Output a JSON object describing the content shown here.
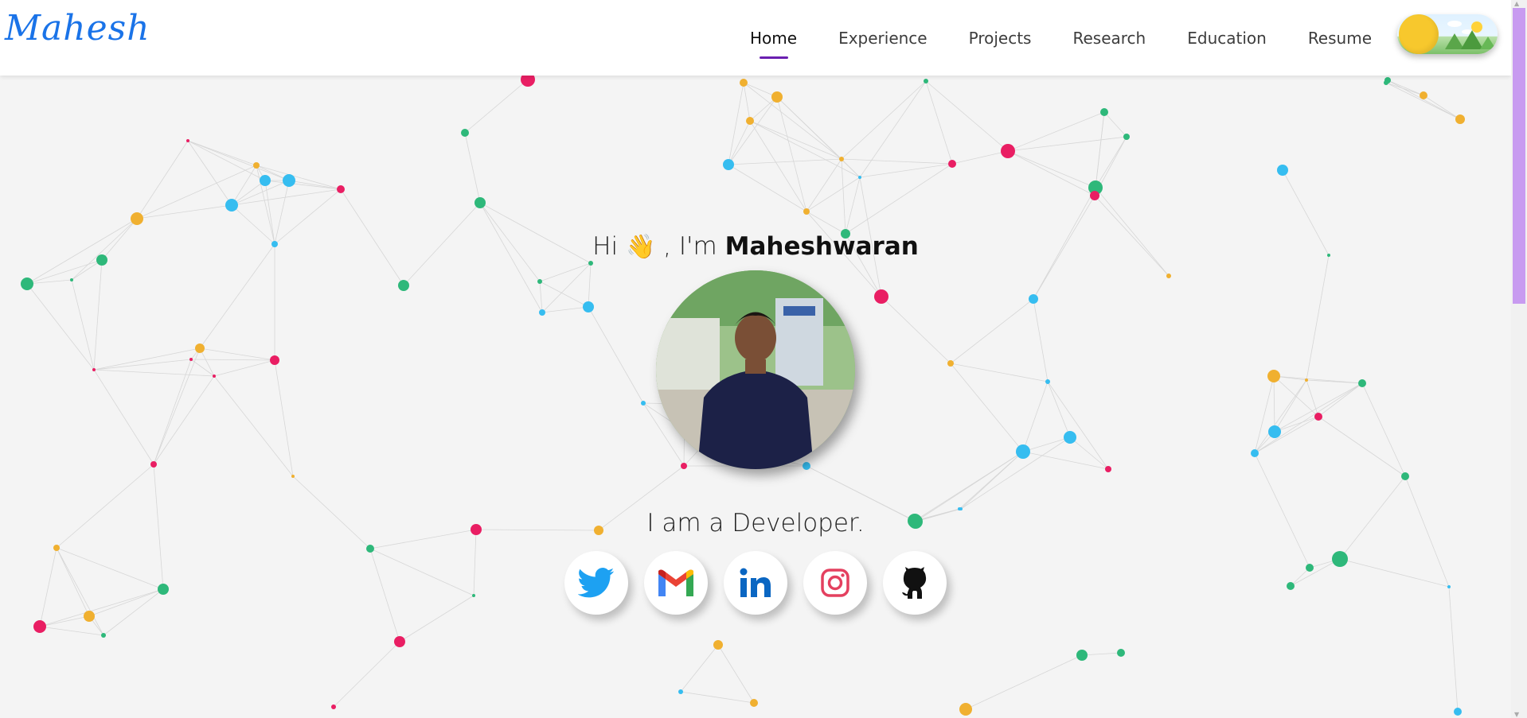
{
  "nav": {
    "logo": "Mahesh",
    "links": [
      {
        "label": "Home",
        "active": true
      },
      {
        "label": "Experience"
      },
      {
        "label": "Projects"
      },
      {
        "label": "Research"
      },
      {
        "label": "Education"
      },
      {
        "label": "Resume"
      }
    ],
    "theme_toggle_icon": "sun-theme-icon"
  },
  "hero": {
    "greeting_prefix": "Hi",
    "wave_emoji": "👋",
    "greeting_mid": ", I'm",
    "name": "Maheshwaran",
    "tagline": "I am a Developer.",
    "avatar_icon": "profile-photo"
  },
  "socials": [
    {
      "icon": "twitter-icon",
      "color": "#1da1f2"
    },
    {
      "icon": "gmail-icon",
      "color": "#ea4335"
    },
    {
      "icon": "linkedin-icon",
      "color": "#0a66c2"
    },
    {
      "icon": "instagram-icon",
      "color": "#e4405f"
    },
    {
      "icon": "github-icon",
      "color": "#111111"
    }
  ],
  "colors": {
    "particle_colors": [
      "#e91e63",
      "#f0b030",
      "#2eb87a",
      "#36bdf0"
    ],
    "nav_underline": "#6a1fb0",
    "scroll_thumb": "#c89bf0"
  }
}
